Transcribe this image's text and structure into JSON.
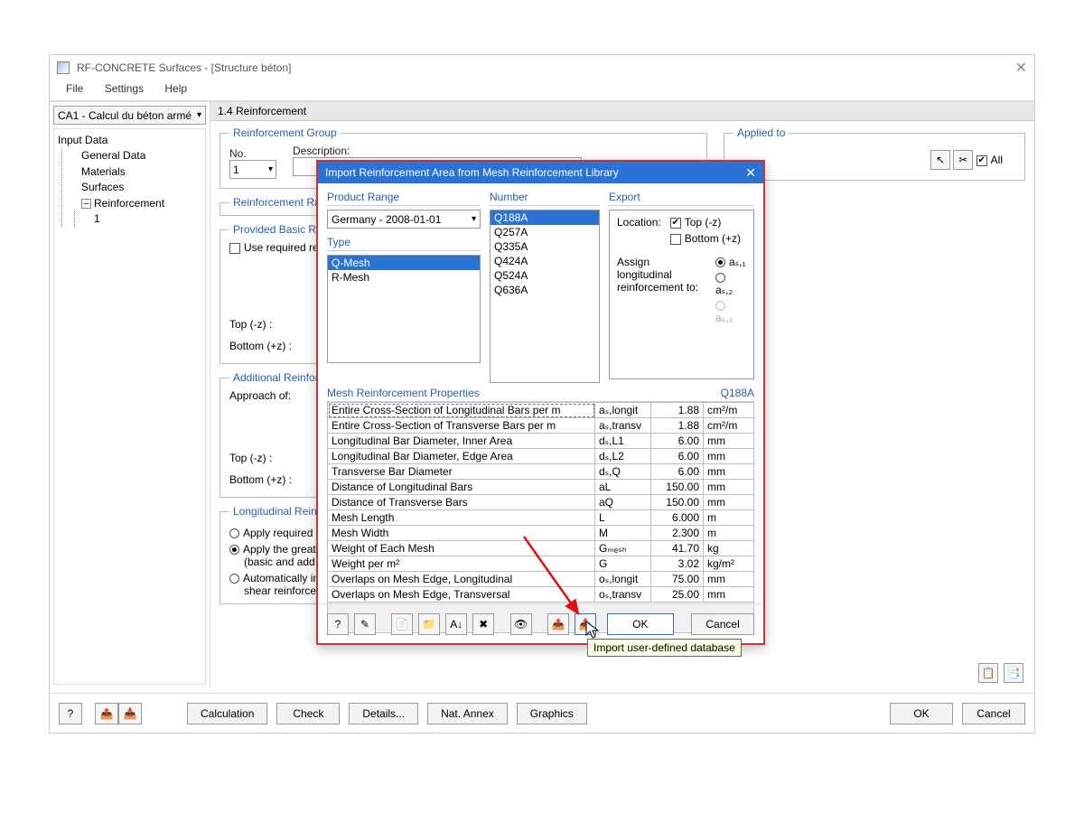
{
  "titlebar": {
    "title": "RF-CONCRETE Surfaces - [Structure béton]"
  },
  "menubar": {
    "file": "File",
    "settings": "Settings",
    "help": "Help"
  },
  "case_selector": "CA1 - Calcul du béton armé",
  "tree": {
    "root": "Input Data",
    "c1": "General Data",
    "c2": "Materials",
    "c3": "Surfaces",
    "c4": "Reinforcement",
    "c4a": "1"
  },
  "section_title": "1.4 Reinforcement",
  "grp_reinf": {
    "legend": "Reinforcement Group",
    "no_label": "No.",
    "no_value": "1",
    "desc_label": "Description:"
  },
  "grp_applied": {
    "legend": "Applied to",
    "all": "All"
  },
  "grp_ratio": {
    "legend": "Reinforcement Ratio"
  },
  "grp_basic": {
    "legend": "Provided Basic Reinforcement",
    "chk": "Use required reinforcement for serviceability",
    "top": "Top (-z) :",
    "bottom": "Bottom (+z) :"
  },
  "grp_add": {
    "legend": "Additional Reinforcement",
    "approach": "Approach of:",
    "top": "Top (-z) :",
    "bottom": "Bottom (+z) :"
  },
  "grp_long": {
    "legend": "Longitudinal Reinforcement",
    "r1": "Apply required longitudinal",
    "r2a": "Apply the greater of",
    "r2b": "(basic and add. reinforcement)",
    "r3a": "Automatically increase",
    "r3b": "shear reinforcement"
  },
  "bottom_buttons": {
    "calc": "Calculation",
    "check": "Check",
    "details": "Details...",
    "annex": "Nat. Annex",
    "graphics": "Graphics",
    "ok": "OK",
    "cancel": "Cancel"
  },
  "modal": {
    "title": "Import Reinforcement Area from Mesh Reinforcement Library",
    "product_range_label": "Product Range",
    "product_range_value": "Germany - 2008-01-01",
    "type_label": "Type",
    "types": [
      "Q-Mesh",
      "R-Mesh"
    ],
    "number_label": "Number",
    "numbers": [
      "Q188A",
      "Q257A",
      "Q335A",
      "Q424A",
      "Q524A",
      "Q636A"
    ],
    "export_label": "Export",
    "location_label": "Location:",
    "top_label": "Top (-z)",
    "bottom_label": "Bottom (+z)",
    "assign_label": "Assign longitudinal reinforcement to:",
    "as1": "aₛ,₁",
    "as2": "aₛ,₂",
    "as3": "aₛ,₃",
    "props_label": "Mesh Reinforcement Properties",
    "props_code": "Q188A",
    "rows": [
      {
        "d": "Entire Cross-Section of Longitudinal Bars per m",
        "s": "aₛ,longit",
        "v": "1.88",
        "u": "cm²/m"
      },
      {
        "d": "Entire Cross-Section of Transverse Bars per m",
        "s": "aₛ,transv",
        "v": "1.88",
        "u": "cm²/m"
      },
      {
        "d": "Longitudinal Bar Diameter, Inner Area",
        "s": "dₛ,L1",
        "v": "6.00",
        "u": "mm"
      },
      {
        "d": "Longitudinal Bar Diameter, Edge Area",
        "s": "dₛ,L2",
        "v": "6.00",
        "u": "mm"
      },
      {
        "d": "Transverse Bar Diameter",
        "s": "dₛ,Q",
        "v": "6.00",
        "u": "mm"
      },
      {
        "d": "Distance of Longitudinal Bars",
        "s": "aL",
        "v": "150.00",
        "u": "mm"
      },
      {
        "d": "Distance of Transverse Bars",
        "s": "aQ",
        "v": "150.00",
        "u": "mm"
      },
      {
        "d": "Mesh Length",
        "s": "L",
        "v": "6.000",
        "u": "m"
      },
      {
        "d": "Mesh Width",
        "s": "M",
        "v": "2.300",
        "u": "m"
      },
      {
        "d": "Weight of Each Mesh",
        "s": "Gₘₑₛₕ",
        "v": "41.70",
        "u": "kg"
      },
      {
        "d": "Weight per m²",
        "s": "G",
        "v": "3.02",
        "u": "kg/m²"
      },
      {
        "d": "Overlaps on Mesh Edge, Longitudinal",
        "s": "oₛ,longit",
        "v": "75.00",
        "u": "mm"
      },
      {
        "d": "Overlaps on Mesh Edge, Transversal",
        "s": "oₛ,transv",
        "v": "25.00",
        "u": "mm"
      }
    ],
    "ok": "OK",
    "cancel": "Cancel",
    "tooltip": "Import user-defined database"
  },
  "icons": {
    "help": "?",
    "edit": "✎",
    "new": "📄",
    "sort": "A↓",
    "del": "✖",
    "eye": "👁",
    "copy1": "📋",
    "copy2": "📑",
    "pick": "↖",
    "scissors": "✂"
  },
  "chart_data": null
}
